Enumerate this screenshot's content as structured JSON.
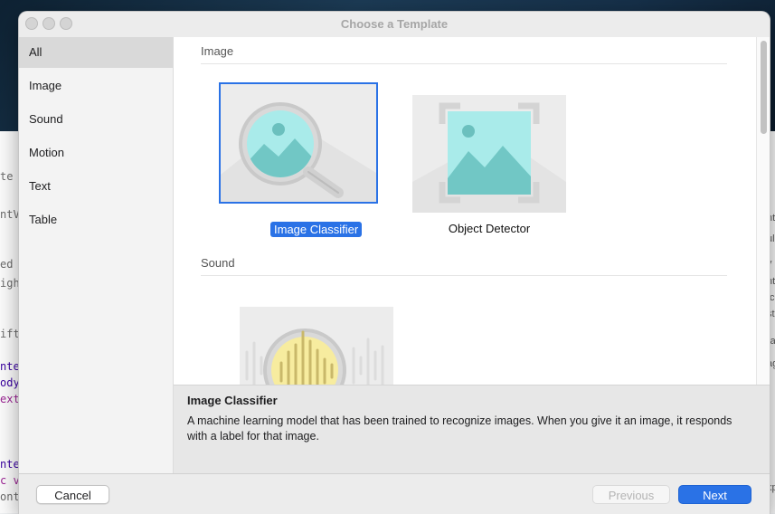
{
  "window": {
    "title": "Choose a Template"
  },
  "sidebar": {
    "items": [
      {
        "label": "All",
        "selected": true
      },
      {
        "label": "Image",
        "selected": false
      },
      {
        "label": "Sound",
        "selected": false
      },
      {
        "label": "Motion",
        "selected": false
      },
      {
        "label": "Text",
        "selected": false
      },
      {
        "label": "Table",
        "selected": false
      }
    ]
  },
  "sections": [
    {
      "title": "Image",
      "templates": [
        {
          "label": "Image Classifier",
          "icon": "image-classifier-icon",
          "selected": true
        },
        {
          "label": "Object Detector",
          "icon": "object-detector-icon",
          "selected": false
        }
      ]
    },
    {
      "title": "Sound",
      "templates": [
        {
          "label": "",
          "icon": "sound-classifier-icon",
          "selected": false
        }
      ]
    }
  ],
  "detail": {
    "title": "Image Classifier",
    "description": "A machine learning model that has been trained to recognize images. When you give it an image, it responds with a label for that image."
  },
  "buttons": {
    "cancel": "Cancel",
    "previous": "Previous",
    "next": "Next"
  },
  "colors": {
    "accent": "#2a72e6",
    "image_tint": "#7fd3d3",
    "sound_tint": "#f6e27a"
  },
  "background": {
    "left_fragments": [
      "te",
      "ntV",
      "ed",
      "igh",
      "ift",
      "nte",
      "ody",
      "ext",
      "nte",
      "c v",
      "ont"
    ],
    "right_fragments": [
      "nt",
      "ul",
      "v",
      "nt",
      "/c",
      "st",
      "ra",
      "ag",
      "xp"
    ]
  }
}
